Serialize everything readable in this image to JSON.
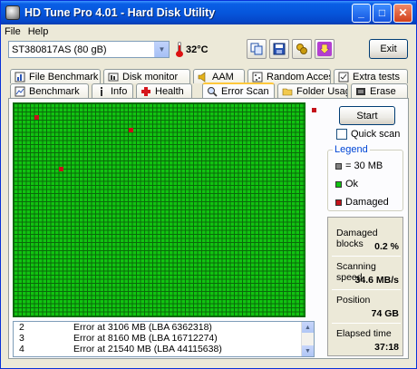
{
  "window": {
    "title": "HD Tune Pro 4.01 - Hard Disk Utility",
    "min": "_",
    "max": "□",
    "close": "✕"
  },
  "menu": {
    "file": "File",
    "help": "Help"
  },
  "toolbar": {
    "drive": "ST380817AS (80 gB)",
    "temperature": "32°C",
    "exit_label": "Exit",
    "icons": [
      "copy-icon",
      "save-icon",
      "options-icon",
      "download-icon"
    ]
  },
  "tabs_row1": [
    {
      "label": "File Benchmark",
      "icon": "file-benchmark-icon"
    },
    {
      "label": "Disk monitor",
      "icon": "disk-monitor-icon"
    },
    {
      "label": "AAM",
      "icon": "speaker-icon"
    },
    {
      "label": "Random Access",
      "icon": "random-access-icon"
    },
    {
      "label": "Extra tests",
      "icon": "extra-tests-icon"
    }
  ],
  "tabs_row2": [
    {
      "label": "Benchmark",
      "icon": "benchmark-icon"
    },
    {
      "label": "Info",
      "icon": "info-icon"
    },
    {
      "label": "Health",
      "icon": "health-icon"
    },
    {
      "label": "Error Scan",
      "icon": "magnifier-icon",
      "active": true
    },
    {
      "label": "Folder Usage",
      "icon": "folder-icon"
    },
    {
      "label": "Erase",
      "icon": "erase-icon"
    }
  ],
  "scan": {
    "start_label": "Start",
    "quick_scan_label": "Quick scan",
    "quick_scan_checked": false,
    "legend": {
      "title": "Legend",
      "block_size": "= 30 MB",
      "ok": "Ok",
      "damaged": "Damaged",
      "colors": {
        "ok": "#11C411",
        "damaged": "#C4121A",
        "unscanned": "#808080"
      }
    },
    "stats": {
      "damaged_blocks_label": "Damaged blocks",
      "damaged_blocks_value": "0.2 %",
      "scanning_speed_label": "Scanning speed",
      "scanning_speed_value": "34.6 MB/s",
      "position_label": "Position",
      "position_value": "74 GB",
      "elapsed_label": "Elapsed time",
      "elapsed_value": "37:18"
    },
    "errors": [
      {
        "n": "2",
        "text": "Error at 3106 MB (LBA 6362318)"
      },
      {
        "n": "3",
        "text": "Error at 8160 MB (LBA 16712274)"
      },
      {
        "n": "4",
        "text": "Error at 21540 MB (LBA 44115638)"
      }
    ]
  }
}
